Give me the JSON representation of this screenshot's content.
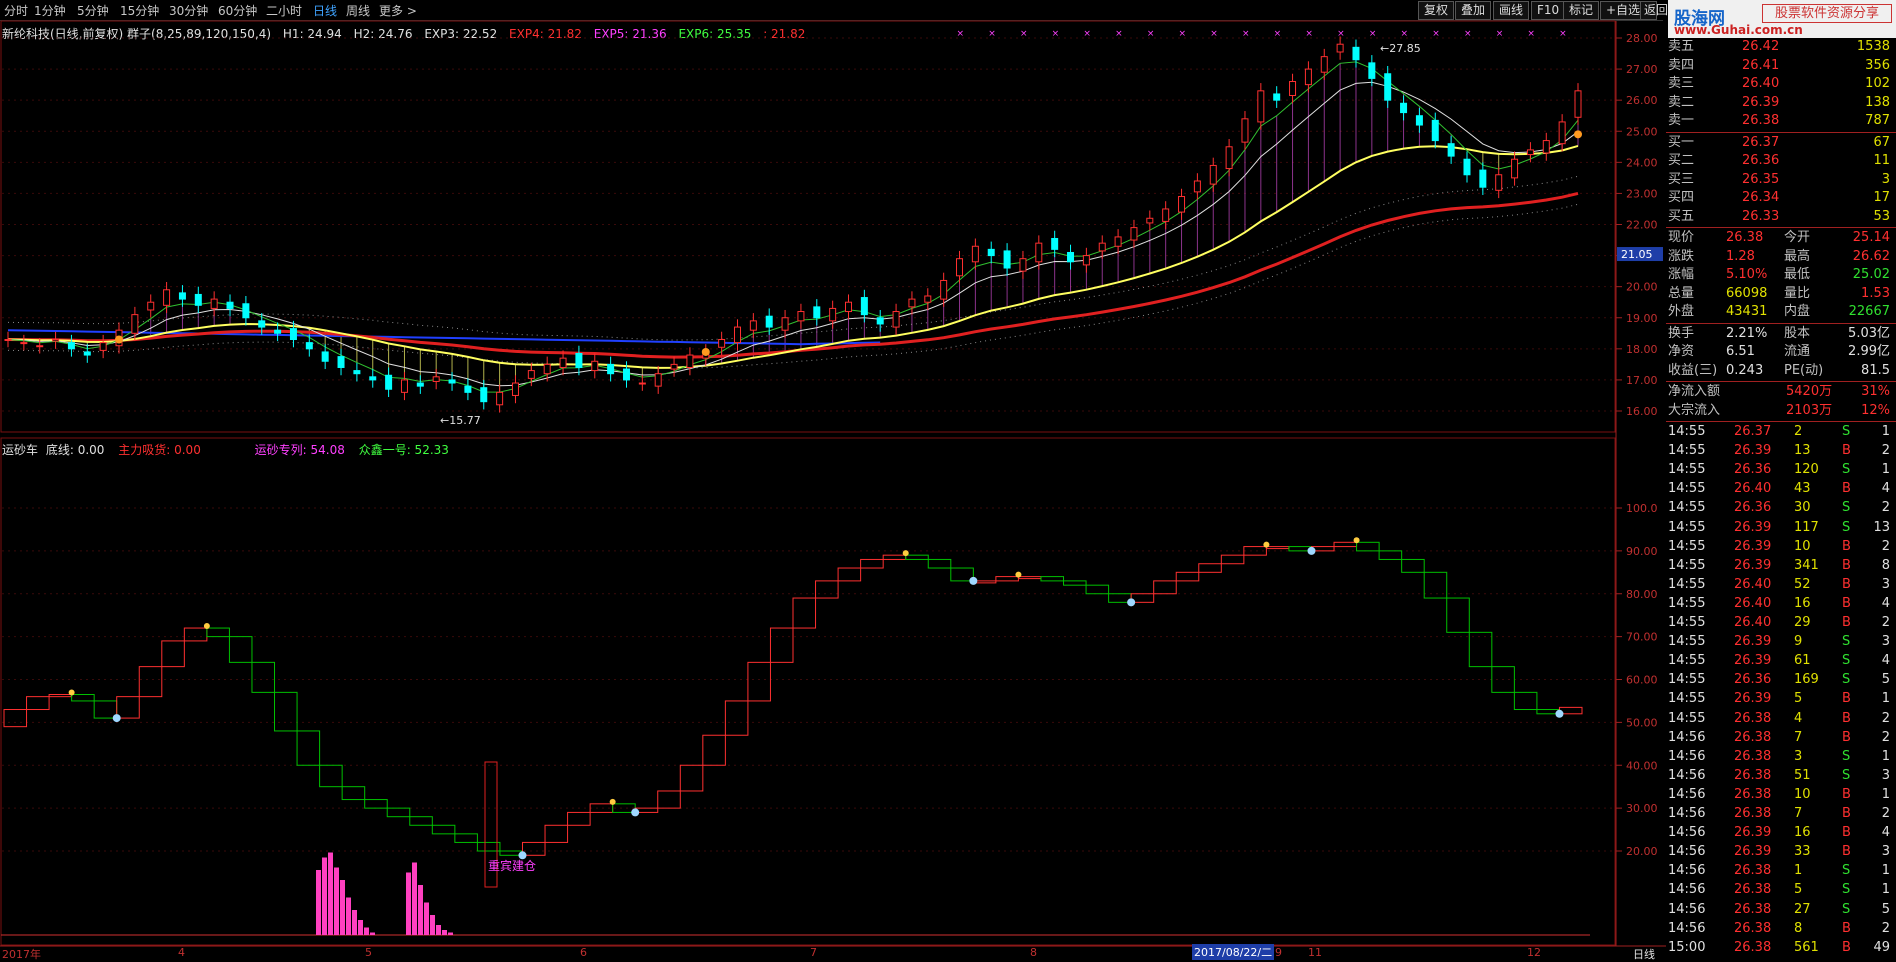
{
  "toolbar": {
    "periods": [
      "分时",
      "1分钟",
      "5分钟",
      "15分钟",
      "30分钟",
      "60分钟",
      "二小时",
      "日线",
      "周线",
      "更多 >"
    ],
    "active_period": "日线",
    "right_buttons": [
      "复权",
      "叠加",
      "画线",
      "F10",
      "标记",
      "+自选",
      "返回"
    ]
  },
  "brand": {
    "logo": "股海网",
    "tagline": "股票软件资源分享",
    "url": "www.Guhai.com.cn"
  },
  "info": {
    "title": "新纶科技(日线,前复权)",
    "formula": "群子(8,25,89,120,150,4)",
    "h1": "H1: 24.94",
    "h2": "H2: 24.76",
    "exp3": "EXP3: 22.52",
    "exp4": "EXP4: 21.82",
    "exp5": "EXP5: 21.36",
    "exp6": "EXP6: 25.35",
    "tail": ": 21.82"
  },
  "indicator": {
    "name": "运砂车",
    "base": "底线: 0.00",
    "main": "主力吸货: 0.00",
    "sand": "运砂专列: 54.08",
    "crowd": "众鑫一号: 52.33",
    "annotation": "重宾建仓"
  },
  "price_axis": {
    "labels": [
      "28.00",
      "27.00",
      "26.00",
      "25.00",
      "24.00",
      "23.00",
      "22.00",
      "21.00",
      "20.00",
      "19.00",
      "18.00",
      "17.00",
      "16.00"
    ],
    "current_tag": "21.05"
  },
  "ind_axis": {
    "labels": [
      "100.0",
      "90.00",
      "80.00",
      "70.00",
      "60.00",
      "50.00",
      "40.00",
      "30.00",
      "20.00"
    ]
  },
  "price_marks": {
    "high": "27.85",
    "low": "15.77"
  },
  "x_axis": {
    "labels": [
      "2017年",
      "4",
      "5",
      "6",
      "7",
      "8",
      "9",
      "11",
      "12"
    ],
    "date_box": "2017/08/22/二",
    "period": "日线"
  },
  "chart_data": {
    "type": "candlestick",
    "title": "",
    "price_range": [
      15.5,
      28.2
    ],
    "closes": [
      18.3,
      18.2,
      18.1,
      18.3,
      18.0,
      17.8,
      18.2,
      18.6,
      19.1,
      19.5,
      19.9,
      19.6,
      19.4,
      19.6,
      19.3,
      19.0,
      18.7,
      18.5,
      18.3,
      18.0,
      17.6,
      17.4,
      17.2,
      17.0,
      16.7,
      17.0,
      16.8,
      17.1,
      16.9,
      16.6,
      16.3,
      16.6,
      16.9,
      17.3,
      17.5,
      17.7,
      17.4,
      17.6,
      17.2,
      17.0,
      16.9,
      17.2,
      17.5,
      17.8,
      17.9,
      18.3,
      18.7,
      18.9,
      18.7,
      19.0,
      19.2,
      19.0,
      19.3,
      19.5,
      19.1,
      18.8,
      19.2,
      19.6,
      19.7,
      20.2,
      20.9,
      21.3,
      21.0,
      20.6,
      20.9,
      21.4,
      21.2,
      20.8,
      21.0,
      21.4,
      21.6,
      21.9,
      22.2,
      22.5,
      22.9,
      23.4,
      23.9,
      24.5,
      25.4,
      26.3,
      26.0,
      26.6,
      27.0,
      27.4,
      27.8,
      27.3,
      26.7,
      26.0,
      25.6,
      25.2,
      24.7,
      24.2,
      23.6,
      23.2,
      23.6,
      24.1,
      24.4,
      24.7,
      25.3,
      26.3
    ],
    "sand_line": [
      49,
      53,
      56,
      56.5,
      55,
      51,
      56,
      63,
      69,
      72,
      70,
      64,
      57,
      48,
      40,
      35,
      32,
      30,
      28,
      26,
      24,
      22,
      20,
      19,
      22,
      26,
      29,
      31,
      29,
      30,
      34,
      40,
      47,
      55,
      64,
      72,
      79,
      83,
      86,
      88,
      89,
      88,
      86,
      83,
      83,
      84,
      84,
      83,
      82,
      80,
      78,
      80,
      83,
      85,
      87,
      89,
      91,
      91,
      90,
      91,
      92,
      90,
      88,
      85,
      79,
      71,
      63,
      57,
      53,
      52,
      53.5
    ],
    "main_bars": [
      26,
      31,
      33,
      27,
      22,
      15,
      10,
      6,
      3,
      1,
      0,
      0,
      0,
      0,
      0,
      25,
      29,
      20,
      13,
      8,
      4,
      2,
      1
    ]
  },
  "order_book": {
    "sell": [
      {
        "label": "卖五",
        "price": "26.42",
        "vol": "1538"
      },
      {
        "label": "卖四",
        "price": "26.41",
        "vol": "356"
      },
      {
        "label": "卖三",
        "price": "26.40",
        "vol": "102"
      },
      {
        "label": "卖二",
        "price": "26.39",
        "vol": "138"
      },
      {
        "label": "卖一",
        "price": "26.38",
        "vol": "787"
      }
    ],
    "buy": [
      {
        "label": "买一",
        "price": "26.37",
        "vol": "67"
      },
      {
        "label": "买二",
        "price": "26.36",
        "vol": "11"
      },
      {
        "label": "买三",
        "price": "26.35",
        "vol": "3"
      },
      {
        "label": "买四",
        "price": "26.34",
        "vol": "17"
      },
      {
        "label": "买五",
        "price": "26.33",
        "vol": "53"
      }
    ]
  },
  "stats": [
    {
      "k1": "现价",
      "v1": "26.38",
      "k2": "今开",
      "v2": "25.14"
    },
    {
      "k1": "涨跌",
      "v1": "1.28",
      "k2": "最高",
      "v2": "26.62"
    },
    {
      "k1": "涨幅",
      "v1": "5.10%",
      "k2": "最低",
      "v2": "25.02"
    },
    {
      "k1": "总量",
      "v1": "66098",
      "k2": "量比",
      "v2": "1.53"
    },
    {
      "k1": "外盘",
      "v1": "43431",
      "k2": "内盘",
      "v2": "22667"
    },
    {
      "k1": "换手",
      "v1": "2.21%",
      "k2": "股本",
      "v2": "5.03亿"
    },
    {
      "k1": "净资",
      "v1": "6.51",
      "k2": "流通",
      "v2": "2.99亿"
    },
    {
      "k1": "收益(三)",
      "v1": "0.243",
      "k2": "PE(动)",
      "v2": "81.5"
    }
  ],
  "flows": [
    {
      "k": "净流入额",
      "v": "5420万",
      "p": "31%"
    },
    {
      "k": "大宗流入",
      "v": "2103万",
      "p": "12%"
    }
  ],
  "ticks": [
    [
      "14:55",
      "26.37",
      "2",
      "S",
      "1"
    ],
    [
      "14:55",
      "26.39",
      "13",
      "B",
      "2"
    ],
    [
      "14:55",
      "26.36",
      "120",
      "S",
      "1"
    ],
    [
      "14:55",
      "26.40",
      "43",
      "B",
      "4"
    ],
    [
      "14:55",
      "26.36",
      "30",
      "S",
      "2"
    ],
    [
      "14:55",
      "26.39",
      "117",
      "S",
      "13"
    ],
    [
      "14:55",
      "26.39",
      "10",
      "B",
      "2"
    ],
    [
      "14:55",
      "26.39",
      "341",
      "B",
      "8"
    ],
    [
      "14:55",
      "26.40",
      "52",
      "B",
      "3"
    ],
    [
      "14:55",
      "26.40",
      "16",
      "B",
      "4"
    ],
    [
      "14:55",
      "26.40",
      "29",
      "B",
      "2"
    ],
    [
      "14:55",
      "26.39",
      "9",
      "S",
      "3"
    ],
    [
      "14:55",
      "26.39",
      "61",
      "S",
      "4"
    ],
    [
      "14:55",
      "26.36",
      "169",
      "S",
      "5"
    ],
    [
      "14:55",
      "26.39",
      "5",
      "B",
      "1"
    ],
    [
      "14:55",
      "26.38",
      "4",
      "B",
      "2"
    ],
    [
      "14:56",
      "26.38",
      "7",
      "B",
      "2"
    ],
    [
      "14:56",
      "26.38",
      "3",
      "S",
      "1"
    ],
    [
      "14:56",
      "26.38",
      "51",
      "S",
      "3"
    ],
    [
      "14:56",
      "26.38",
      "10",
      "B",
      "1"
    ],
    [
      "14:56",
      "26.38",
      "7",
      "B",
      "2"
    ],
    [
      "14:56",
      "26.39",
      "16",
      "B",
      "4"
    ],
    [
      "14:56",
      "26.39",
      "33",
      "B",
      "3"
    ],
    [
      "14:56",
      "26.38",
      "1",
      "S",
      "1"
    ],
    [
      "14:56",
      "26.38",
      "5",
      "S",
      "1"
    ],
    [
      "14:56",
      "26.38",
      "27",
      "S",
      "5"
    ],
    [
      "14:56",
      "26.38",
      "8",
      "B",
      "2"
    ],
    [
      "15:00",
      "26.38",
      "561",
      "B",
      "49"
    ]
  ],
  "colors": {
    "up": "#ff3030",
    "down": "#00ffff",
    "yellow": "#ffff60",
    "red_ma": "#e02020",
    "blue_ma": "#2040ff",
    "magenta": "#ff40ff",
    "green_line": "#00c000"
  }
}
